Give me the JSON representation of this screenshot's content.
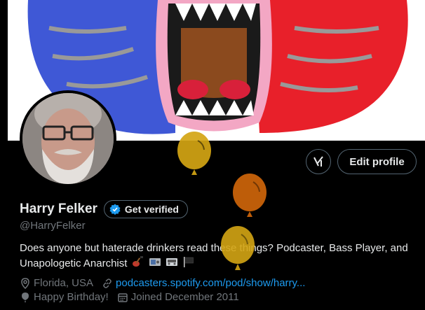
{
  "profile": {
    "name": "Harry Felker",
    "handle": "@HarryFelker",
    "bio": "Does anyone but haterade drinkers read these things? Podcaster, Bass Player, and Unapologetic Anarchist",
    "location": "Florida, USA",
    "website": "podcasters.spotify.com/pod/show/harry...",
    "birthday": "Happy Birthday!",
    "joined": "Joined December 2011"
  },
  "buttons": {
    "edit_profile": "Edit profile",
    "get_verified": "Get verified"
  },
  "colors": {
    "background": "#000000",
    "text_primary": "#e7e9ea",
    "text_secondary": "#71767b",
    "link": "#1d9bf0",
    "border": "#536471",
    "balloon_gold": "#d4a514",
    "balloon_orange": "#c8620a"
  },
  "icons": {
    "grok": "grok-icon",
    "verified": "verified-badge-icon",
    "location": "location-pin-icon",
    "link": "link-icon",
    "birthday": "balloon-icon",
    "calendar": "calendar-icon"
  }
}
